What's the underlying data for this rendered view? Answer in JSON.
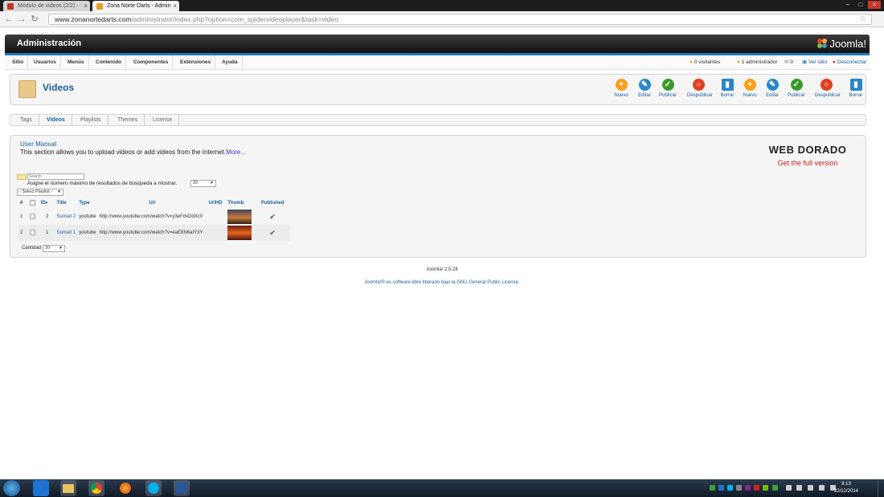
{
  "browser": {
    "tabs": [
      {
        "label": "Módulo de videos (2/2) - ·"
      },
      {
        "label": "Zona Norte Darts - Admin"
      }
    ],
    "url_domain": "www.zonanortedarts.com",
    "url_path": "/administrator/index.php?option=com_spidervideoplayer&task=video"
  },
  "header": {
    "title": "Administración",
    "logo_text": "Joomla!"
  },
  "menu": {
    "items": [
      "Sitio",
      "Usuarios",
      "Menús",
      "Contenido",
      "Componentes",
      "Extensiones",
      "Ayuda"
    ],
    "status": {
      "visitors": "0 visitantes",
      "admins": "1 administrador",
      "messages": "0",
      "view_site": "Ver sitio",
      "logout": "Desconectar"
    }
  },
  "toolbar": {
    "page_title": "Videos",
    "buttons": [
      {
        "label": "Nuevo",
        "color": "#f6a11a"
      },
      {
        "label": "Editar",
        "color": "#2a86c8"
      },
      {
        "label": "Publicar",
        "color": "#3a9a28"
      },
      {
        "label": "Despublicar",
        "color": "#e0401e"
      },
      {
        "label": "Borrar",
        "color": "#2a86c8"
      },
      {
        "label": "Nuevo",
        "color": "#f6a11a"
      },
      {
        "label": "Editar",
        "color": "#2a86c8"
      },
      {
        "label": "Publicar",
        "color": "#3a9a28"
      },
      {
        "label": "Despublicar",
        "color": "#e0401e"
      },
      {
        "label": "Borrar",
        "color": "#2a86c8"
      }
    ]
  },
  "subtabs": [
    "Tags",
    "Videos",
    "Playlists",
    "Themes",
    "License"
  ],
  "content": {
    "manual_link": "User Manual",
    "description": "This section allows you to upload videos or add videos from the Internet.",
    "more_link": "More...",
    "vendor_logo": "WEB DORADO",
    "vendor_cta": "Get the full version",
    "search_placeholder": "Search",
    "limit_label": "Asigne el número máximo de resultados de búsqueda a mostrar.",
    "limit_value": "20",
    "playlist_select": "- Select Playlist -",
    "columns": [
      "#",
      "ID",
      "Title",
      "Type",
      "Url",
      "UrlHD",
      "Thumb",
      "Published"
    ],
    "rows": [
      {
        "num": "1",
        "id": "2",
        "title": "Sunset 2",
        "type": "youtube",
        "url": "http://www.youtube.com/watch?v=y3eFdvDdXc0"
      },
      {
        "num": "2",
        "id": "1",
        "title": "Sunset 1",
        "type": "youtube",
        "url": "http://www.youtube.com/watch?v=eaE8N6aIY3Y"
      }
    ],
    "count_label": "Cantidad",
    "count_value": "20"
  },
  "footer": {
    "version": "Joomla! 2.5.28",
    "license_prefix": "Joomla!® es software libre liberado bajo la",
    "license_link": "GNU General Public License."
  },
  "taskbar": {
    "time": "9:13",
    "date": "22/12/2014"
  }
}
